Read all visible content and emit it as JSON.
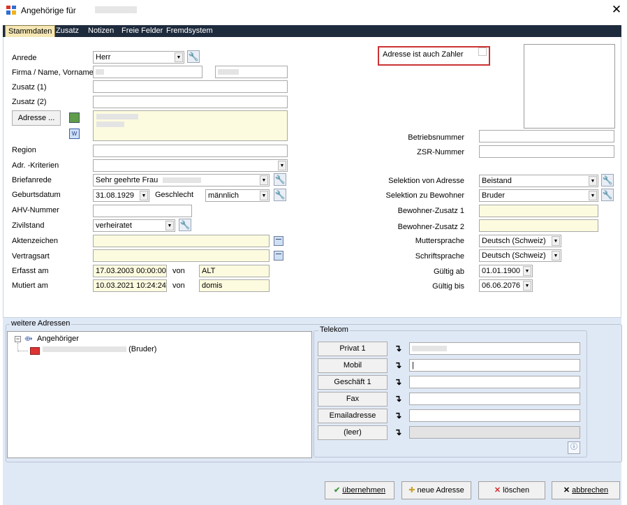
{
  "window": {
    "title": "Angehörige für",
    "close": "✕"
  },
  "tabs": [
    {
      "label": "Stammdaten",
      "active": true
    },
    {
      "label": "Zusatz"
    },
    {
      "label": "Notizen"
    },
    {
      "label": "Freie Felder"
    },
    {
      "label": "Fremdsystem"
    }
  ],
  "form": {
    "anrede_label": "Anrede",
    "anrede_value": "Herr",
    "firma_label": "Firma / Name, Vorname",
    "zusatz1_label": "Zusatz (1)",
    "zusatz2_label": "Zusatz (2)",
    "adresse_button": "Adresse ...",
    "region_label": "Region",
    "adr_kriterien_label": "Adr. -Kriterien",
    "briefanrede_label": "Briefanrede",
    "briefanrede_value": "Sehr geehrte Frau",
    "geburtsdatum_label": "Geburtsdatum",
    "geburtsdatum_value": "31.08.1929",
    "geschlecht_label": "Geschlecht",
    "geschlecht_value": "männlich",
    "ahv_label": "AHV-Nummer",
    "zivilstand_label": "Zivilstand",
    "zivilstand_value": "verheiratet",
    "aktenzeichen_label": "Aktenzeichen",
    "vertragsart_label": "Vertragsart",
    "erfasst_label": "Erfasst am",
    "erfasst_value": "17.03.2003 00:00:00",
    "erfasst_von_label": "von",
    "erfasst_von_value": "ALT",
    "mutiert_label": "Mutiert am",
    "mutiert_value": "10.03.2021 10:24:24",
    "mutiert_von_label": "von",
    "mutiert_von_value": "domis"
  },
  "right": {
    "zahler_label": "Adresse ist auch Zahler",
    "betriebsnummer_label": "Betriebsnummer",
    "zsr_label": "ZSR-Nummer",
    "selektion_von_label": "Selektion von Adresse",
    "selektion_von_value": "Beistand",
    "selektion_zu_label": "Selektion zu Bewohner",
    "selektion_zu_value": "Bruder",
    "bewohner_zusatz1_label": "Bewohner-Zusatz 1",
    "bewohner_zusatz2_label": "Bewohner-Zusatz 2",
    "muttersprache_label": "Muttersprache",
    "muttersprache_value": "Deutsch (Schweiz)",
    "schriftsprache_label": "Schriftsprache",
    "schriftsprache_value": "Deutsch (Schweiz)",
    "gueltig_ab_label": "Gültig ab",
    "gueltig_ab_value": "01.01.1900",
    "gueltig_bis_label": "Gültig bis",
    "gueltig_bis_value": "06.06.2076"
  },
  "weitere": {
    "title": "weitere Adressen",
    "root": "Angehöriger",
    "child_suffix": "(Bruder)"
  },
  "telekom": {
    "title": "Telekom",
    "rows": [
      {
        "label": "Privat 1"
      },
      {
        "label": "Mobil"
      },
      {
        "label": "Geschäft 1"
      },
      {
        "label": "Fax"
      },
      {
        "label": "Emailadresse"
      },
      {
        "label": "(leer)"
      }
    ]
  },
  "footer": {
    "uebernehmen": "übernehmen",
    "neue_adresse": "neue Adresse",
    "loeschen": "löschen",
    "abbrechen": "abbrechen"
  }
}
